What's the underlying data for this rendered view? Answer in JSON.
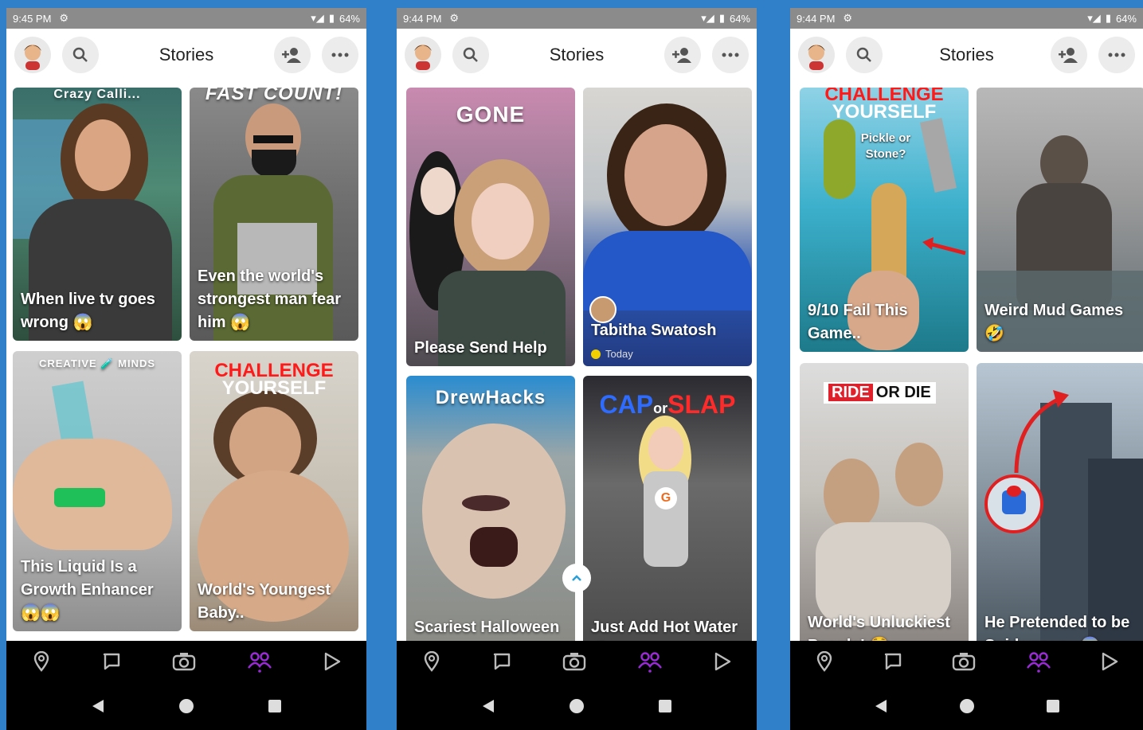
{
  "phones": [
    {
      "status": {
        "time": "9:45 PM",
        "battery": "64%"
      },
      "header": {
        "title": "Stories"
      },
      "cards": [
        {
          "caption": "When live tv goes wrong 😱",
          "overlay": "Crazy Calli..."
        },
        {
          "caption": "Even the world's strongest man fear him 😱",
          "overlay": "FAST COUNT!"
        },
        {
          "caption": "This Liquid Is a Growth Enhancer 😱😱",
          "overlay": "CREATIVE 🧪 MINDS"
        },
        {
          "caption": "World's Youngest Baby..",
          "overlay_red": "CHALLENGE",
          "overlay_white": "YOURSELF"
        }
      ]
    },
    {
      "status": {
        "time": "9:44 PM",
        "battery": "64%"
      },
      "header": {
        "title": "Stories"
      },
      "cards": [
        {
          "caption": "Please Send Help",
          "overlay": "GONE"
        },
        {
          "caption": "Tabitha Swatosh",
          "sub": "Today"
        },
        {
          "caption": "Scariest Halloween Mask",
          "overlay": "DrewHacks"
        },
        {
          "caption": "Just Add Hot Water 😱",
          "overlay_blue": "CAP",
          "overlay_or": "or",
          "overlay_red": "SLAP"
        }
      ]
    },
    {
      "status": {
        "time": "9:44 PM",
        "battery": "64%"
      },
      "header": {
        "title": "Stories"
      },
      "cards": [
        {
          "caption": "9/10 Fail This Game..",
          "overlay_red": "CHALLENGE",
          "overlay_white": "YOURSELF",
          "small": "Pickle or Stone?"
        },
        {
          "caption": "Weird Mud Games 🤣"
        },
        {
          "caption": "World's Unluckiest People! 😳",
          "overlay_red": "RIDE",
          "overlay_white": "OR DIE"
        },
        {
          "caption": "He Pretended to be Spiderman.. 😱"
        }
      ]
    }
  ],
  "nav_icons": [
    "map-icon",
    "chat-icon",
    "camera-icon",
    "stories-icon",
    "spotlight-icon"
  ],
  "colors": {
    "accent": "#9b2bd8",
    "background": "#2f80c8",
    "statusbar": "#8b8b8b"
  }
}
